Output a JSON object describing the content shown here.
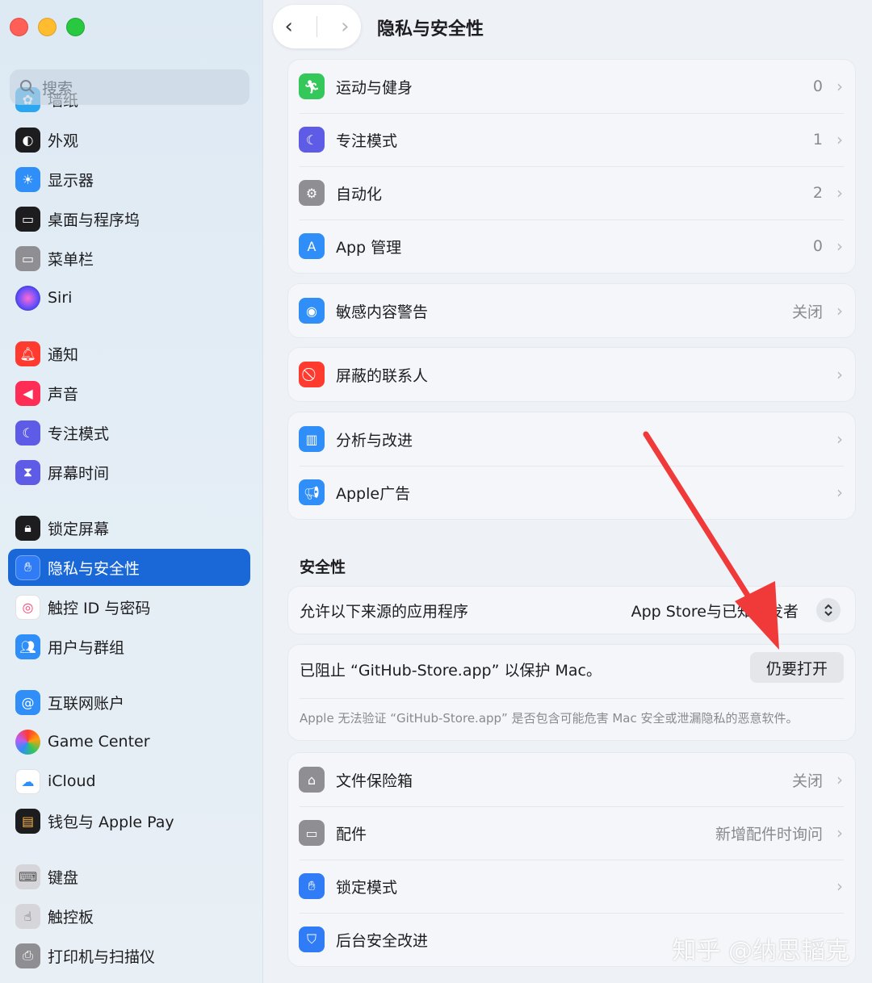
{
  "window": {
    "title": "隐私与安全性"
  },
  "search": {
    "placeholder": "搜索"
  },
  "sidebar": {
    "items": [
      {
        "label": "墙纸",
        "icon": "wallpaper-icon",
        "color": "#2aa7f0"
      },
      {
        "label": "外观",
        "icon": "appearance-icon",
        "color": "#1d1d1f"
      },
      {
        "label": "显示器",
        "icon": "display-icon",
        "color": "#2f8ef7"
      },
      {
        "label": "桌面与程序坞",
        "icon": "dock-icon",
        "color": "#1d1d1f"
      },
      {
        "label": "菜单栏",
        "icon": "menubar-icon",
        "color": "#8e8e93"
      },
      {
        "label": "Siri",
        "icon": "siri-icon",
        "color": "#3a3a6a"
      },
      {
        "label": "通知",
        "icon": "bell-icon",
        "color": "#ff3b30"
      },
      {
        "label": "声音",
        "icon": "speaker-icon",
        "color": "#ff2d55"
      },
      {
        "label": "专注模式",
        "icon": "moon-icon",
        "color": "#5e5ce6"
      },
      {
        "label": "屏幕时间",
        "icon": "hourglass-icon",
        "color": "#5e5ce6"
      },
      {
        "label": "锁定屏幕",
        "icon": "lock-icon",
        "color": "#1d1d1f"
      },
      {
        "label": "隐私与安全性",
        "icon": "hand-icon",
        "color": "#2f7cf6"
      },
      {
        "label": "触控 ID 与密码",
        "icon": "fingerprint-icon",
        "color": "#ffffff"
      },
      {
        "label": "用户与群组",
        "icon": "users-icon",
        "color": "#2f8ef7"
      },
      {
        "label": "互联网账户",
        "icon": "at-icon",
        "color": "#2f8ef7"
      },
      {
        "label": "Game Center",
        "icon": "game-center-icon",
        "color": "#ff9f0a"
      },
      {
        "label": "iCloud",
        "icon": "cloud-icon",
        "color": "#ffffff"
      },
      {
        "label": "钱包与 Apple Pay",
        "icon": "wallet-icon",
        "color": "#1d1d1f"
      },
      {
        "label": "键盘",
        "icon": "keyboard-icon",
        "color": "#b0b0b5"
      },
      {
        "label": "触控板",
        "icon": "trackpad-icon",
        "color": "#b0b0b5"
      },
      {
        "label": "打印机与扫描仪",
        "icon": "printer-icon",
        "color": "#8e8e93"
      }
    ]
  },
  "privacy_group_1": [
    {
      "label": "运动与健身",
      "value": "0",
      "icon": "fitness-icon",
      "color": "#34c759"
    },
    {
      "label": "专注模式",
      "value": "1",
      "icon": "moon-icon",
      "color": "#5e5ce6"
    },
    {
      "label": "自动化",
      "value": "2",
      "icon": "gears-icon",
      "color": "#8e8e93"
    },
    {
      "label": "App 管理",
      "value": "0",
      "icon": "app-store-icon",
      "color": "#2f8ef7"
    }
  ],
  "sensitive": {
    "label": "敏感内容警告",
    "value": "关闭",
    "icon": "eye-icon",
    "color": "#2f8ef7"
  },
  "blocked_contacts": {
    "label": "屏蔽的联系人",
    "icon": "blocked-icon",
    "color": "#ff3b30"
  },
  "privacy_group_2": [
    {
      "label": "分析与改进",
      "icon": "analytics-icon",
      "color": "#2f8ef7"
    },
    {
      "label": "Apple广告",
      "icon": "megaphone-icon",
      "color": "#2f8ef7"
    }
  ],
  "security": {
    "title": "安全性",
    "allow_label": "允许以下来源的应用程序",
    "allow_value": "App Store与已知开发者",
    "blocked_message": "已阻止 “GitHub-Store.app” 以保护 Mac。",
    "open_button": "仍要打开",
    "note": "Apple 无法验证 “GitHub-Store.app” 是否包含可能危害 Mac 安全或泄漏隐私的恶意软件。"
  },
  "security_group": [
    {
      "label": "文件保险箱",
      "value": "关闭",
      "icon": "filevault-icon",
      "color": "#8e8e93"
    },
    {
      "label": "配件",
      "value": "新增配件时询问",
      "icon": "accessory-icon",
      "color": "#8e8e93"
    },
    {
      "label": "锁定模式",
      "value": "",
      "icon": "hand-icon",
      "color": "#2f7cf6"
    },
    {
      "label": "后台安全改进",
      "value": "",
      "icon": "shield-icon",
      "color": "#2f7cf6"
    }
  ],
  "watermark": "知乎 @纳思韬克",
  "annotation": {
    "arrow_color": "#f03a3a"
  }
}
